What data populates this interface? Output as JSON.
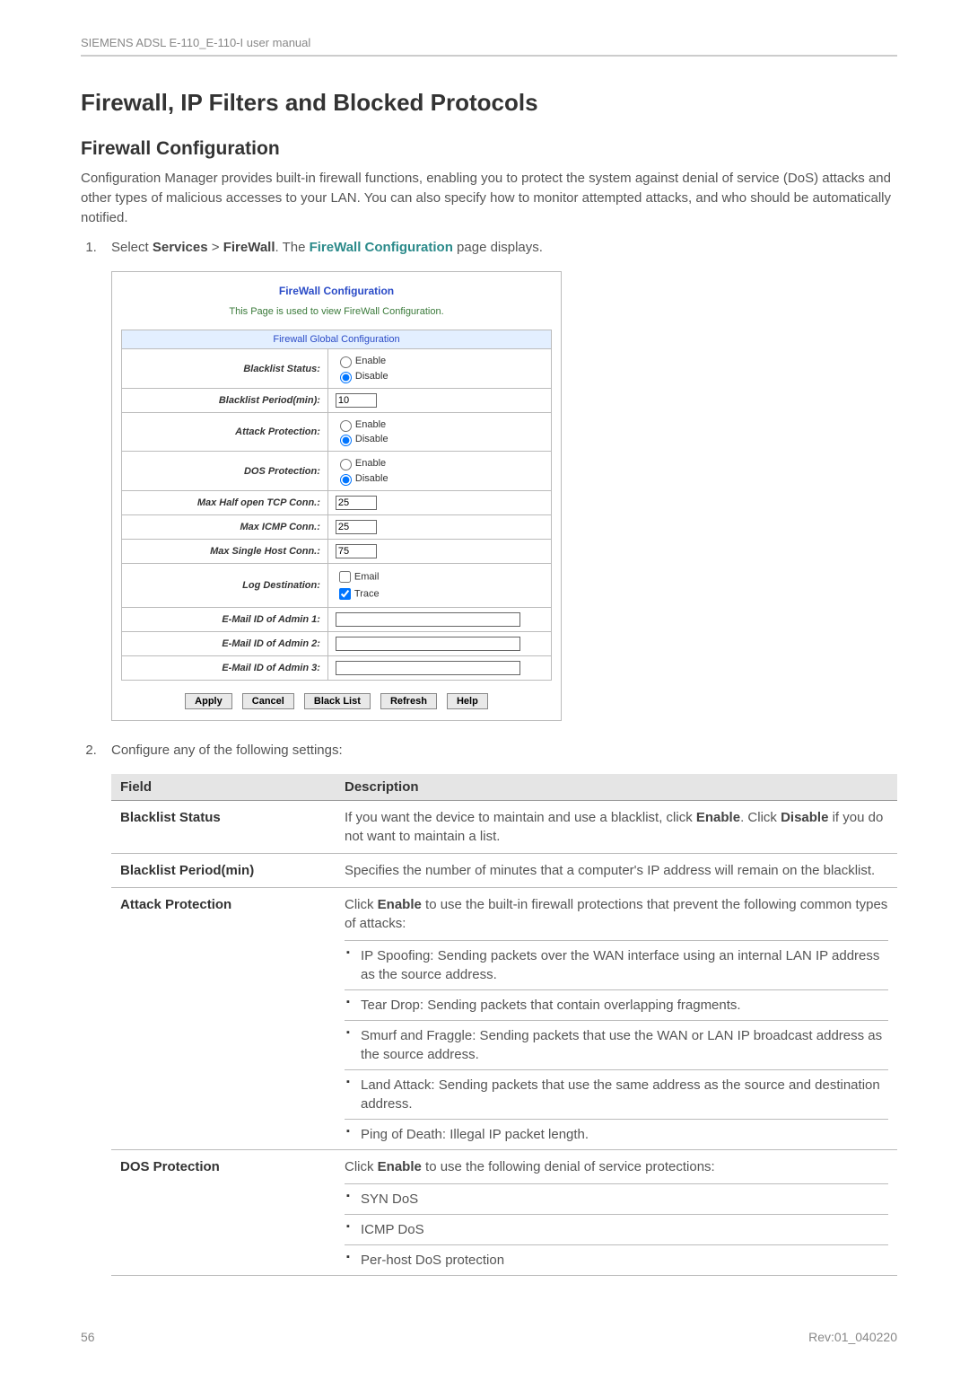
{
  "doc": {
    "header_left": "SIEMENS ADSL E-110_E-110-I user manual",
    "footer_left": "56",
    "footer_right": "Rev:01_040220"
  },
  "headings": {
    "h1": "Firewall, IP Filters and Blocked Protocols",
    "h2": "Firewall Configuration"
  },
  "body": {
    "intro": "Configuration Manager provides built-in firewall functions, enabling you to protect the system against denial of service (DoS) attacks and other types of malicious accesses to your LAN. You can also specify how to monitor attempted attacks, and who should be automatically notified.",
    "step1_pre": "Select ",
    "step1_services": "Services",
    "step1_sep": " > ",
    "step1_firewall": "FireWall",
    "step1_post1": ". The ",
    "step1_link": "FireWall Configuration",
    "step1_post2": " page displays.",
    "step2": "Configure any of the following settings:"
  },
  "panel": {
    "title": "FireWall Configuration",
    "subtitle": "This Page is used to view FireWall Configuration.",
    "banner": "Firewall Global Configuration",
    "rows": {
      "blacklist_status": "Blacklist Status:",
      "blacklist_period": "Blacklist Period(min):",
      "attack_protection": "Attack Protection:",
      "dos_protection": "DOS Protection:",
      "max_half_open": "Max Half open TCP Conn.:",
      "max_icmp": "Max ICMP Conn.:",
      "max_single_host": "Max Single Host Conn.:",
      "log_destination": "Log Destination:",
      "email1": "E-Mail ID of Admin 1:",
      "email2": "E-Mail ID of Admin 2:",
      "email3": "E-Mail ID of Admin 3:"
    },
    "values": {
      "blacklist_period": "10",
      "max_half_open": "25",
      "max_icmp": "25",
      "max_single_host": "75"
    },
    "options": {
      "enable": "Enable",
      "disable": "Disable",
      "email": "Email",
      "trace": "Trace"
    },
    "buttons": {
      "apply": "Apply",
      "cancel": "Cancel",
      "black_list": "Black List",
      "refresh": "Refresh",
      "help": "Help"
    }
  },
  "desc_table": {
    "head_field": "Field",
    "head_desc": "Description",
    "blacklist_status": {
      "label": "Blacklist Status",
      "text_pre": "If you want the device to maintain and use a blacklist, click ",
      "enable": "Enable",
      "text_mid": ". Click ",
      "disable": "Disable",
      "text_post": " if you do not want to maintain a list."
    },
    "blacklist_period": {
      "label": "Blacklist Period(min)",
      "text": "Specifies the number of minutes that a computer's IP address will remain on the blacklist."
    },
    "attack_protection": {
      "label": "Attack Protection",
      "text_pre": "Click ",
      "enable": "Enable",
      "text_post": " to use the built-in firewall protections that prevent the following common types of attacks:",
      "bullets": [
        "IP Spoofing: Sending packets over the WAN interface using an internal LAN IP address as the source address.",
        "Tear Drop: Sending packets that contain overlapping fragments.",
        "Smurf and Fraggle: Sending packets that use the WAN or LAN IP broadcast address as the source address.",
        "Land Attack: Sending packets that use the same address as   the source and destination address.",
        "Ping of Death: Illegal IP packet length."
      ]
    },
    "dos_protection": {
      "label": "DOS Protection",
      "text_pre": "Click ",
      "enable": "Enable",
      "text_post": " to use the following denial of service protections:",
      "bullets": [
        "SYN DoS",
        "ICMP DoS",
        "Per-host DoS protection"
      ]
    }
  }
}
